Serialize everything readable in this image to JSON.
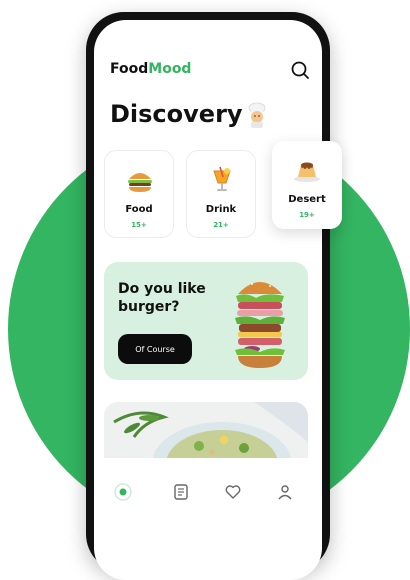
{
  "header": {
    "brand_part1": "Food",
    "brand_part2": "Mood",
    "title": "Discovery"
  },
  "categories": [
    {
      "name": "Food",
      "count": "15+"
    },
    {
      "name": "Drink",
      "count": "21+"
    },
    {
      "name": "Desert",
      "count": "19+"
    }
  ],
  "promo": {
    "line1": "Do you like",
    "line2": "burger?",
    "button_label": "Of Course"
  },
  "icons": {
    "search": "search-icon",
    "chef": "chef-emoji",
    "food": "burger-icon",
    "drink": "cocktail-icon",
    "desert": "pudding-icon",
    "nav": [
      "home-icon",
      "notes-icon",
      "heart-icon",
      "profile-icon"
    ]
  },
  "colors": {
    "accent": "#33b561",
    "promo_bg": "#d7f0df",
    "button_bg": "#0c0c0c"
  }
}
